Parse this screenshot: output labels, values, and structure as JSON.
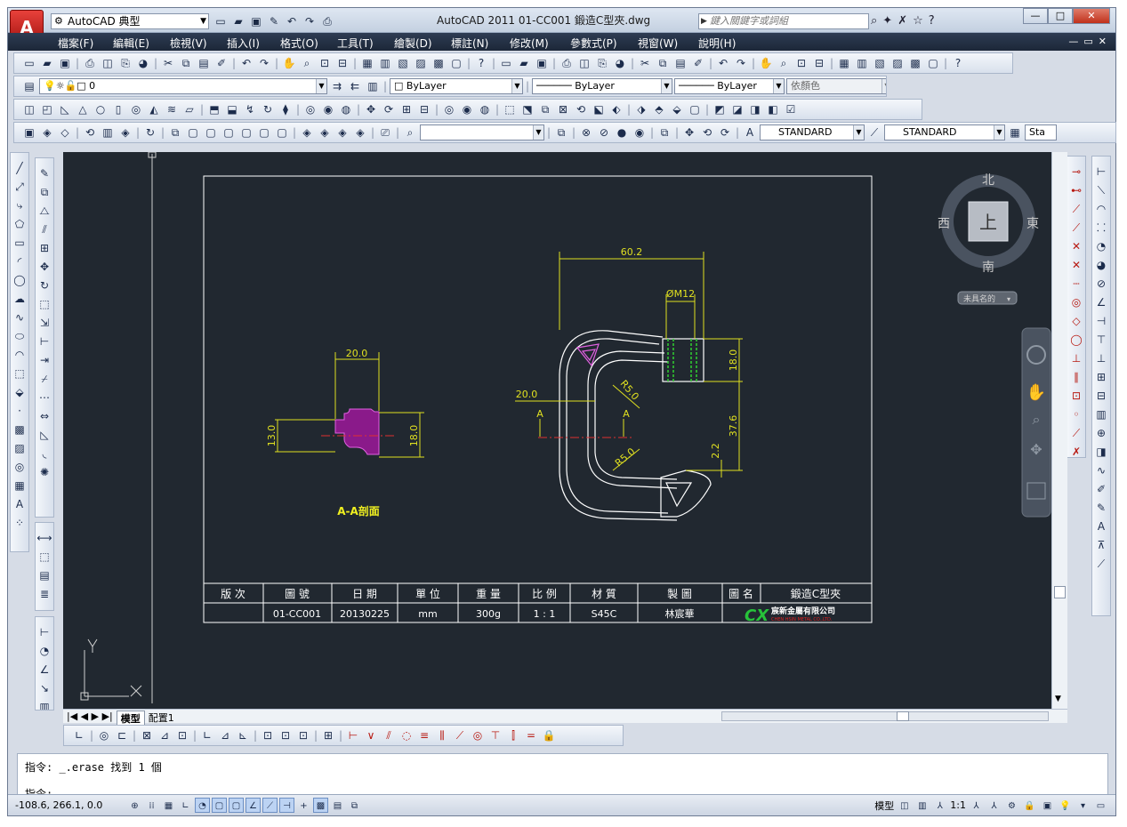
{
  "window": {
    "title": "AutoCAD 2011    01-CC001 鍛造C型夾.dwg",
    "workspace": "AutoCAD 典型",
    "search_placeholder": "鍵入關鍵字或詞組",
    "minimize": "—",
    "restore": "□",
    "close": "✕"
  },
  "menu": [
    "檔案(F)",
    "編輯(E)",
    "檢視(V)",
    "插入(I)",
    "格式(O)",
    "工具(T)",
    "繪製(D)",
    "標註(N)",
    "修改(M)",
    "參數式(P)",
    "視窗(W)",
    "說明(H)"
  ],
  "layers": {
    "current_layer": "0",
    "color": "ByLayer",
    "linetype": "ByLayer",
    "lineweight": "ByLayer",
    "plotstyle": "依顏色"
  },
  "styles": {
    "text_style": "STANDARD",
    "dim_style": "STANDARD",
    "table_style": "Sta"
  },
  "viewcube": {
    "north": "北",
    "south": "南",
    "east": "東",
    "west": "西",
    "face": "上",
    "ucs": "未具名的"
  },
  "drawing": {
    "section_label": "A-A剖面",
    "dims": {
      "width_60": "60.2",
      "thread": "ØM12",
      "height_18": "18.0",
      "height_37": "37.6",
      "offset_22": "2.2",
      "left_20": "20.0",
      "r50_a": "R5.0",
      "r50_b": "R5.0",
      "sec_20": "20.0",
      "sec_13": "13.0",
      "sec_18": "18.0",
      "section_mark_a": "A"
    },
    "title_block": {
      "headers": [
        "版 次",
        "圖 號",
        "日 期",
        "單 位",
        "重 量",
        "比 例",
        "材 質",
        "製 圖",
        "圖 名"
      ],
      "values": [
        "",
        "01-CC001",
        "20130225",
        "mm",
        "300g",
        "1 : 1",
        "S45C",
        "林宸華"
      ],
      "part_name": "鍛造C型夾",
      "company": "宸新金屬有限公司",
      "company_en": "CHEN HSIN METAL CO.,LTD."
    }
  },
  "tabs": {
    "model": "模型",
    "layout1": "配置1"
  },
  "command": {
    "history": "指令: _.erase 找到 1 個",
    "prompt": "指令:"
  },
  "status": {
    "coords": "-108.6, 266.1, 0.0",
    "model_label": "模型",
    "scale": "1:1"
  }
}
